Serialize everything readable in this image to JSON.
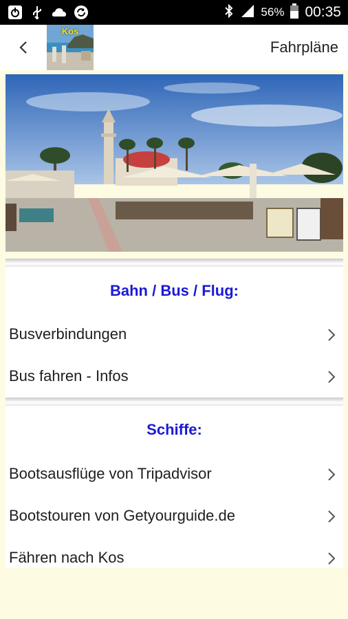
{
  "status_bar": {
    "battery_percent": "56%",
    "time": "00:35",
    "icons_left": [
      "power-icon",
      "usb-icon",
      "cloud-icon",
      "sync-icon"
    ],
    "icons_right": [
      "bluetooth-icon",
      "signal-icon",
      "battery-icon"
    ]
  },
  "app_bar": {
    "thumbnail_label": "Kos",
    "title": "Fahrpläne"
  },
  "sections": [
    {
      "heading": "Bahn / Bus / Flug:",
      "items": [
        {
          "label": "Busverbindungen"
        },
        {
          "label": "Bus fahren - Infos"
        }
      ]
    },
    {
      "heading": "Schiffe:",
      "items": [
        {
          "label": "Bootsausflüge von Tripadvisor"
        },
        {
          "label": "Bootstouren von Getyourguide.de"
        },
        {
          "label": "Fähren nach Kos"
        }
      ]
    }
  ],
  "colors": {
    "heading": "#1a1ad6",
    "background": "#fdfce3",
    "status_bar": "#000000"
  }
}
